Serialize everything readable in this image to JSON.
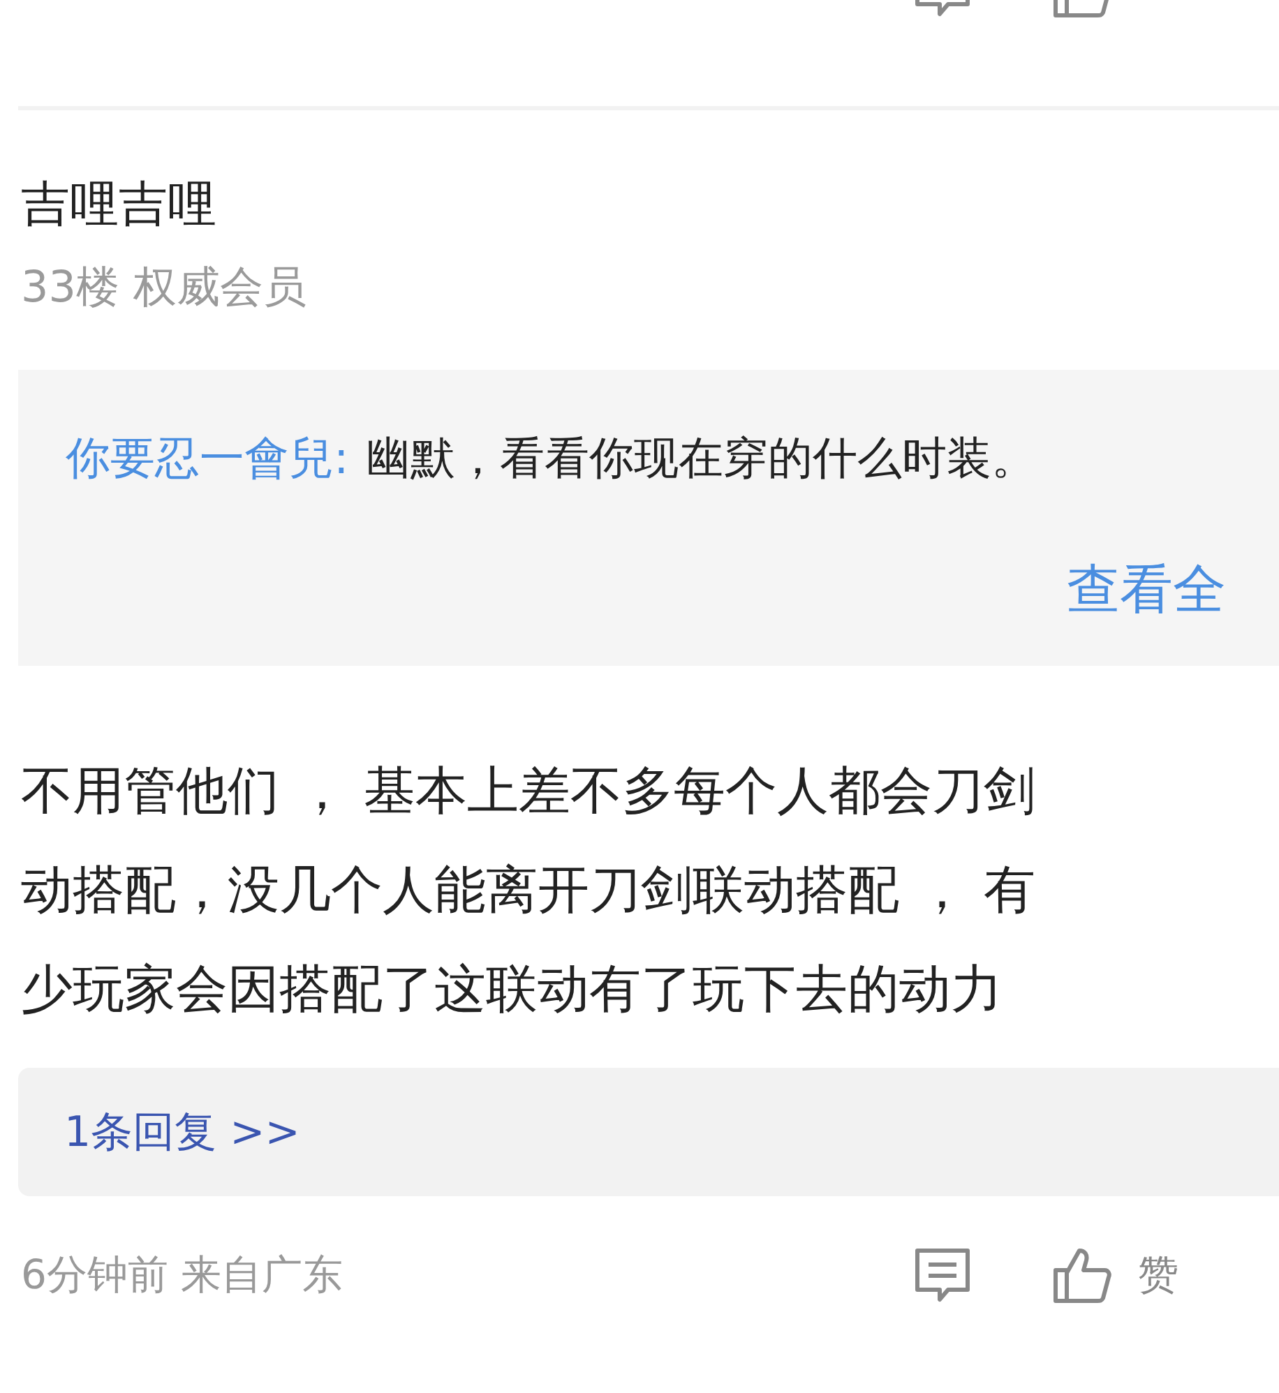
{
  "comment": {
    "author": "吉哩吉哩",
    "subtitle": "33楼 权威会员",
    "quote": {
      "author": "你要忍一會兒:",
      "text": "幽默，看看你现在穿的什么时装。",
      "more_link": "查看全"
    },
    "body_lines": [
      "不用管他们 ， 基本上差不多每个人都会刀剑",
      "动搭配，没几个人能离开刀剑联动搭配 ， 有",
      "少玩家会因搭配了这联动有了玩下去的动力"
    ],
    "replies_link": "1条回复 >>",
    "meta": "6分钟前 来自广东",
    "like_label": "赞"
  }
}
